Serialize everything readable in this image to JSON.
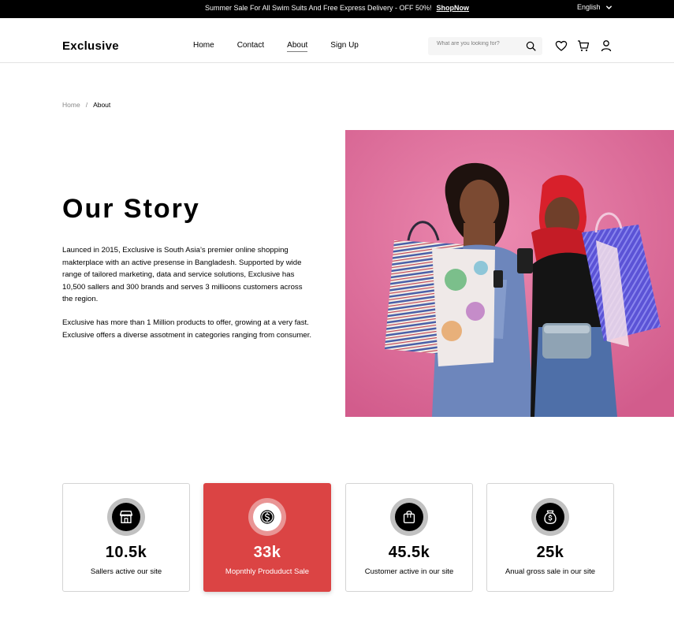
{
  "topbar": {
    "promo_text": "Summer Sale For All Swim Suits And Free Express Delivery - OFF 50%!",
    "shop_link": "ShopNow",
    "language": "English"
  },
  "header": {
    "logo": "Exclusive",
    "nav": [
      {
        "label": "Home"
      },
      {
        "label": "Contact"
      },
      {
        "label": "About",
        "active": true
      },
      {
        "label": "Sign Up"
      }
    ],
    "search_placeholder": "What are you looking for?",
    "icons": [
      "heart-icon",
      "cart-icon",
      "user-icon"
    ]
  },
  "breadcrumb": {
    "home": "Home",
    "separator": "/",
    "current": "About"
  },
  "story": {
    "title": "Our Story",
    "paragraph1": "Launced in 2015, Exclusive is South Asia’s premier online shopping makterplace with an active presense in Bangladesh. Supported by wide range of tailored marketing, data and service solutions, Exclusive has 10,500 sallers and 300 brands and serves 3 millioons customers across the region.",
    "paragraph2": "Exclusive has more than 1 Million products to offer, growing at a very fast. Exclusive offers a diverse assotment in categories ranging  from consumer."
  },
  "stats": [
    {
      "value": "10.5k",
      "label": "Sallers active our site",
      "icon": "shop-icon",
      "active": false
    },
    {
      "value": "33k",
      "label": "Mopnthly Produduct Sale",
      "icon": "dollar-icon",
      "active": true
    },
    {
      "value": "45.5k",
      "label": "Customer active in our site",
      "icon": "shopping-bag-icon",
      "active": false
    },
    {
      "value": "25k",
      "label": "Anual gross sale in our site",
      "icon": "money-bag-icon",
      "active": false
    }
  ],
  "colors": {
    "accent": "#DB4444",
    "hero_background": "#E0709C"
  }
}
